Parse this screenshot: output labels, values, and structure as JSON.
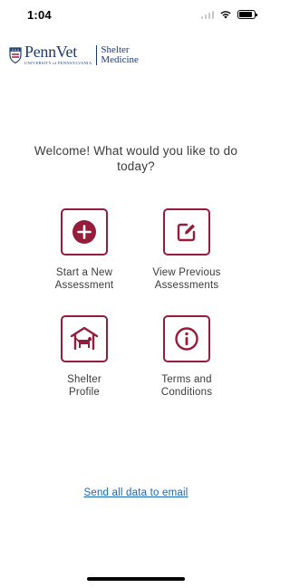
{
  "status_bar": {
    "time": "1:04",
    "battery_level_pct": 85
  },
  "logo": {
    "left_main": "PennVet",
    "left_sub": "UNIVERSITY of PENNSYLVANIA",
    "right_line1": "Shelter",
    "right_line2": "Medicine"
  },
  "welcome": "Welcome! What would you like to do today?",
  "tiles": [
    {
      "icon": "plus-circle-icon",
      "line1": "Start a New",
      "line2": "Assessment"
    },
    {
      "icon": "edit-icon",
      "line1": "View Previous",
      "line2": "Assessments"
    },
    {
      "icon": "shelter-dog-icon",
      "line1": "Shelter",
      "line2": "Profile"
    },
    {
      "icon": "info-icon",
      "line1": "Terms and",
      "line2": "Conditions"
    }
  ],
  "email_link": "Send all data to email",
  "colors": {
    "accent": "#951c3b",
    "logo_blue": "#1f3a70",
    "link": "#1a66b8"
  }
}
